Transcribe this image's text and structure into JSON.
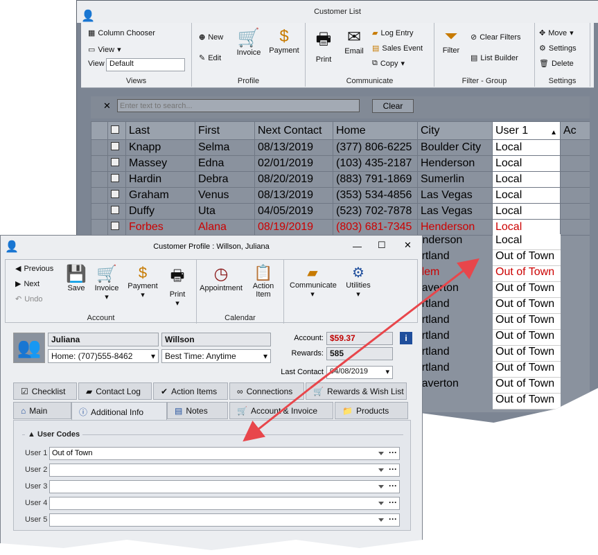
{
  "back": {
    "title": "Customer List",
    "views": {
      "column_chooser": "Column Chooser",
      "view": "View",
      "view_label": "View",
      "view_value": "Default",
      "group": "Views"
    },
    "profile": {
      "new": "New",
      "edit": "Edit",
      "invoice": "Invoice",
      "payment": "Payment",
      "group": "Profile"
    },
    "communicate": {
      "print": "Print",
      "email": "Email",
      "log_entry": "Log Entry",
      "sales_event": "Sales Event",
      "copy": "Copy",
      "group": "Communicate"
    },
    "filter": {
      "filter": "Filter",
      "clear_filters": "Clear Filters",
      "list_builder": "List Builder",
      "group": "Filter - Group"
    },
    "settings": {
      "move": "Move",
      "settings": "Settings",
      "delete": "Delete",
      "group": "Settings"
    },
    "search": {
      "placeholder": "Enter text to search...",
      "clear": "Clear"
    },
    "columns": [
      "Last",
      "First",
      "Next Contact",
      "Home",
      "City",
      "User 1",
      "Ac"
    ],
    "rows": [
      [
        "Knapp",
        "Selma",
        "08/13/2019",
        "(377) 806-6225",
        "Boulder City",
        "Local"
      ],
      [
        "Massey",
        "Edna",
        "02/01/2019",
        "(103) 435-2187",
        "Henderson",
        "Local"
      ],
      [
        "Hardin",
        "Debra",
        "08/20/2019",
        "(883) 791-1869",
        "Sumerlin",
        "Local"
      ],
      [
        "Graham",
        "Venus",
        "08/13/2019",
        "(353) 534-4856",
        "Las Vegas",
        "Local"
      ],
      [
        "Duffy",
        "Uta",
        "04/05/2019",
        "(523) 702-7878",
        "Las Vegas",
        "Local"
      ],
      [
        "Forbes",
        "Alana",
        "08/19/2019",
        "(803) 681-7345",
        "Henderson",
        "Local"
      ]
    ],
    "lower_rows": [
      [
        "Henderson",
        "Local"
      ],
      [
        "Portland",
        "Out of Town"
      ],
      [
        "Salem",
        "Out of Town"
      ],
      [
        "Beaverton",
        "Out of Town"
      ],
      [
        "Portland",
        "Out of Town"
      ],
      [
        "Portland",
        "Out of Town"
      ],
      [
        "Portland",
        "Out of Town"
      ],
      [
        "Portland",
        "Out of Town"
      ],
      [
        "Portland",
        "Out of Town"
      ],
      [
        "Beaverton",
        "Out of Town"
      ],
      [
        "",
        "Out of Town"
      ]
    ]
  },
  "front": {
    "title": "Customer Profile : Willson, Juliana",
    "nav": {
      "previous": "Previous",
      "next": "Next",
      "undo": "Undo"
    },
    "account_grp": {
      "save": "Save",
      "invoice": "Invoice",
      "payment": "Payment",
      "print": "Print",
      "group": "Account"
    },
    "calendar_grp": {
      "appointment": "Appointment",
      "action_item_1": "Action",
      "action_item_2": "Item",
      "group": "Calendar"
    },
    "communicate": "Communicate",
    "utilities": "Utilities",
    "first_name": "Juliana",
    "last_name": "Willson",
    "phone": "Home: (707)555-8462",
    "best_time": "Best Time: Anytime",
    "account_label": "Account:",
    "account_value": "$59.37",
    "rewards_label": "Rewards:",
    "rewards_value": "585",
    "last_contact_label": "Last Contact",
    "last_contact_value": "04/08/2019",
    "tabs_top": [
      "Checklist",
      "Contact Log",
      "Action Items",
      "Connections",
      "Rewards & Wish List"
    ],
    "tabs_bottom": [
      "Main",
      "Additional Info",
      "Notes",
      "Account & Invoice",
      "Products"
    ],
    "user_codes": {
      "title": "User Codes",
      "labels": [
        "User 1",
        "User 2",
        "User 3",
        "User 4",
        "User 5"
      ],
      "values": [
        "Out of Town",
        "",
        "",
        "",
        ""
      ]
    }
  },
  "colors": {
    "arrow": "#e8464b",
    "red_text": "#cc0000",
    "account_red": "#c00000"
  }
}
